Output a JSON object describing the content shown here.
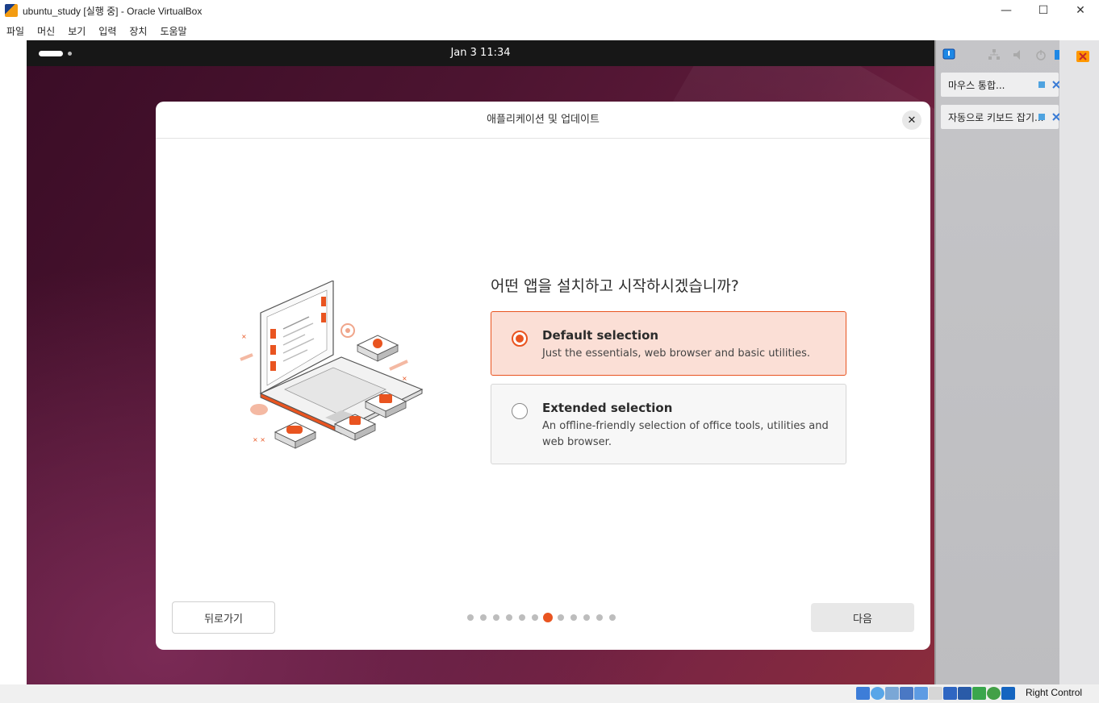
{
  "window": {
    "title": "ubuntu_study [실행 중] - Oracle VirtualBox",
    "minimize": "—",
    "maximize": "☐",
    "close": "✕"
  },
  "menubar": {
    "items": [
      "파일",
      "머신",
      "보기",
      "입력",
      "장치",
      "도움말"
    ]
  },
  "vm": {
    "topbar": {
      "clock": "Jan 3  11:34"
    },
    "dialog": {
      "title": "애플리케이션 및 업데이트",
      "close_glyph": "✕",
      "question": "어떤 앱을 설치하고 시작하시겠습니까?",
      "options": [
        {
          "title": "Default selection",
          "description": "Just the essentials, web browser and basic utilities.",
          "selected": true
        },
        {
          "title": "Extended selection",
          "description": "An offline-friendly selection of office tools, utilities and web browser.",
          "selected": false
        }
      ],
      "back_label": "뒤로가기",
      "next_label": "다음",
      "progress": {
        "total_steps": 12,
        "current_step": 7
      }
    }
  },
  "sidepanel": {
    "notifications": [
      {
        "label": "마우스 통합..."
      },
      {
        "label": "자동으로 키보드 잡기..."
      }
    ]
  },
  "statusbar": {
    "host_key": "Right Control"
  },
  "colors": {
    "accent": "#e95420",
    "selected_bg": "#fbdfd6"
  }
}
